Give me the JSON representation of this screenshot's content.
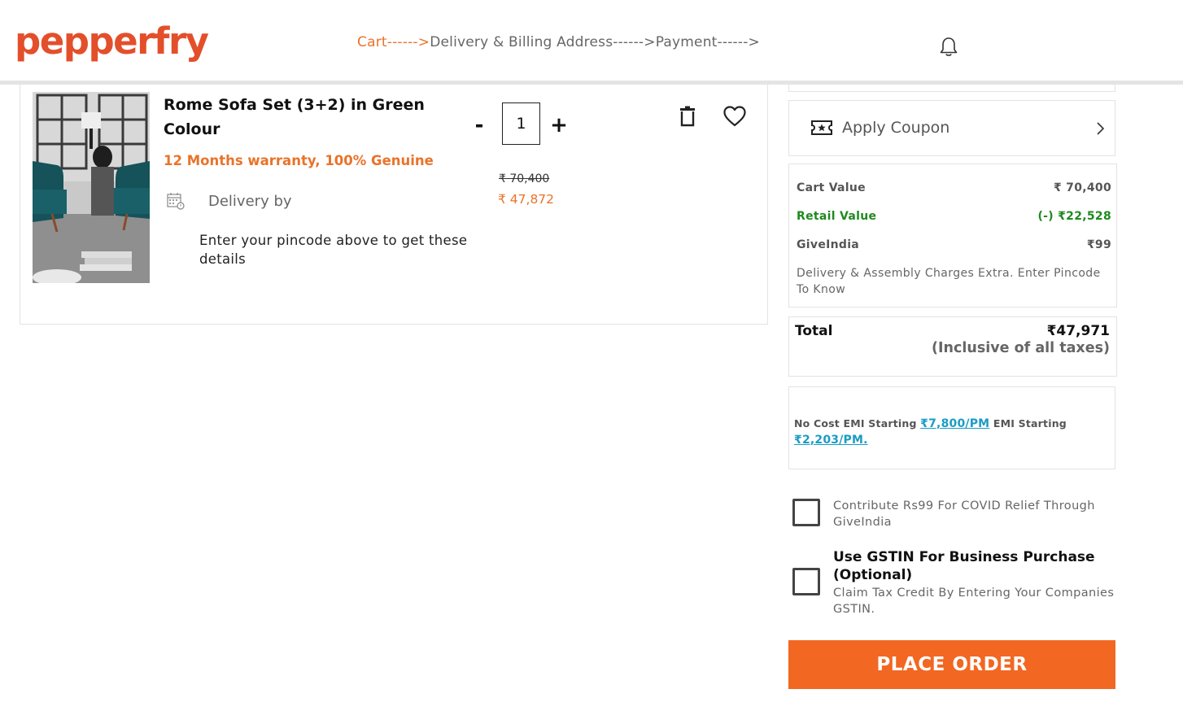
{
  "header": {
    "logo_text": "pepperfry",
    "steps": {
      "cart": "Cart------>",
      "address": "Delivery & Billing Address------>",
      "payment": "Payment------>"
    },
    "notification_icon": "bell-icon"
  },
  "cart_item": {
    "title": "Rome Sofa Set (3+2) in Green Colour",
    "warranty": "12 Months warranty, 100% Genuine",
    "delivery_label": "Delivery by",
    "pincode_message": "Enter your pincode above to get these details",
    "quantity": "1",
    "minus_label": "-",
    "plus_label": "+",
    "price_original": "₹ 70,400",
    "price_offer": "₹ 47,872",
    "delete_icon": "trash-icon",
    "wishlist_icon": "heart-icon"
  },
  "summary": {
    "coupon_label": "Apply Coupon",
    "rows": [
      {
        "label": "Cart Value",
        "value": "₹ 70,400"
      },
      {
        "label": "Retail Value",
        "value": "(-) ₹22,528"
      },
      {
        "label": "GiveIndia",
        "value": "₹99"
      }
    ],
    "charges_note": "Delivery & Assembly Charges Extra. Enter Pincode To Know",
    "total_label": "Total",
    "total_value": "₹47,971",
    "total_tax_note": "(Inclusive of all taxes)",
    "emi": {
      "prefix": "No Cost EMI Starting",
      "no_cost_amount": "₹7,800/PM",
      "middle": "EMI Starting",
      "emi_amount": "₹2,203/PM."
    },
    "covid_text": "Contribute Rs99 For COVID Relief Through GiveIndia",
    "gst_title": "Use GSTIN For Business Purchase (Optional)",
    "gst_text": "Claim Tax Credit By Entering Your Companies GSTIN.",
    "place_order_label": "PLACE ORDER"
  },
  "colors": {
    "brand_orange": "#f26722",
    "accent_orange": "#e9732a",
    "green": "#1e8a1e",
    "link_blue": "#1a9cc4"
  }
}
